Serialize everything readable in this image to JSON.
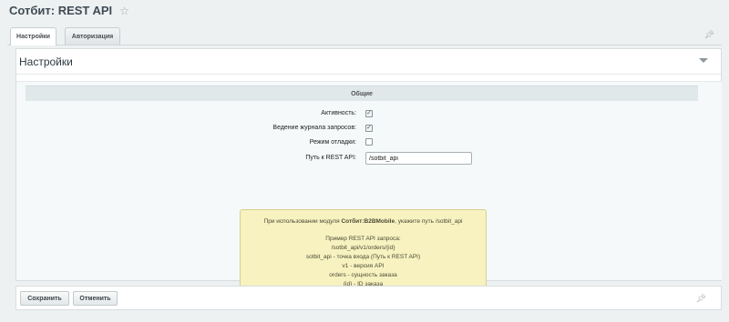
{
  "header": {
    "title": "Сотбит: REST API",
    "favorite_icon": "star-icon"
  },
  "tabs": [
    {
      "label": "Настройки",
      "active": true
    },
    {
      "label": "Авторизация",
      "active": false
    }
  ],
  "panel": {
    "title": "Настройки",
    "section_title": "Общие",
    "fields": {
      "active": {
        "label": "Активность:",
        "checked": true
      },
      "log": {
        "label": "Ведение журнала запросов:",
        "checked": true
      },
      "debug": {
        "label": "Режим отладки:",
        "checked": false
      },
      "path": {
        "label": "Путь к REST API:",
        "value": "/sotbit_api"
      }
    },
    "notice": {
      "intro_prefix": "При использовании модуля ",
      "intro_module": "Сотбит:B2BMobile",
      "intro_suffix": ", укажите путь /sotbit_api",
      "lines": [
        "Пример REST API запроса:",
        "/sotbit_api/v1/orders/{id}",
        "sotbit_api - точка входа (Путь к REST API)",
        "v1 - версия API",
        "orders - сущность заказа",
        "{id} - ID заказа"
      ]
    }
  },
  "footer": {
    "save_label": "Сохранить",
    "cancel_label": "Отменить"
  }
}
